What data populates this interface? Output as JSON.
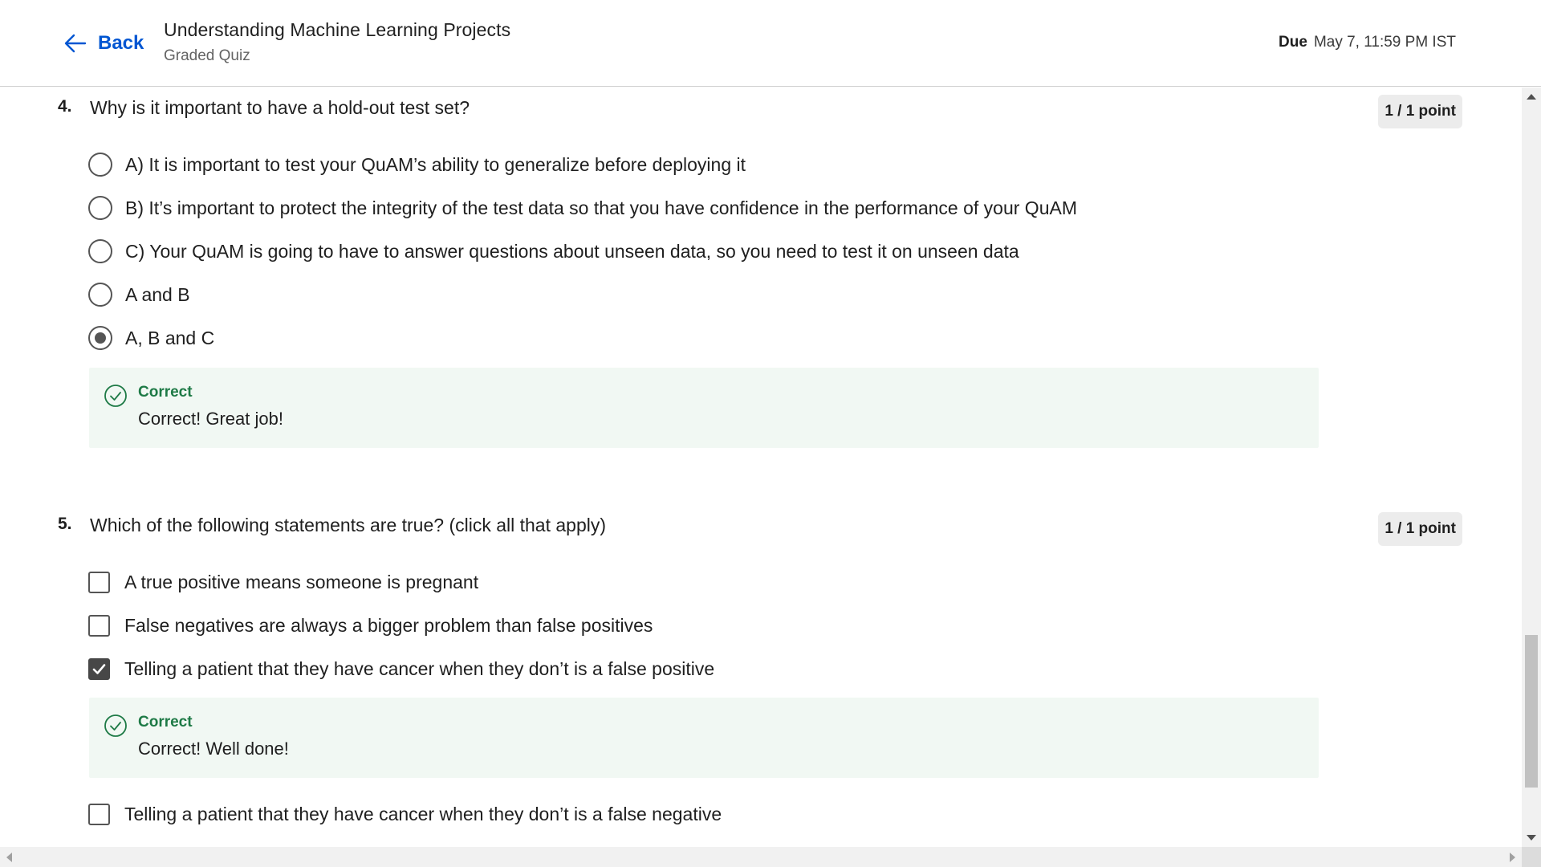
{
  "header": {
    "back_label": "Back",
    "course_title": "Understanding Machine Learning Projects",
    "quiz_type": "Graded Quiz",
    "due_label": "Due",
    "due_value": "May 7, 11:59 PM IST"
  },
  "questions": [
    {
      "number": "4.",
      "text": "Why is it important to have a hold-out test set?",
      "points": "1 / 1 point",
      "input_type": "radio",
      "options": [
        {
          "label": "A) It is important to test your QuAM’s ability to generalize before deploying it",
          "checked": false
        },
        {
          "label": "B) It’s important to protect the integrity of the test data so that you have confidence in the performance of your QuAM",
          "checked": false
        },
        {
          "label": "C) Your QuAM is going to have to answer questions about unseen data, so you need to test it on unseen data",
          "checked": false
        },
        {
          "label": "A and B",
          "checked": false
        },
        {
          "label": "A, B and C",
          "checked": true
        }
      ],
      "feedback": {
        "status": "Correct",
        "message": "Correct! Great job!"
      }
    },
    {
      "number": "5.",
      "text": "Which of the following statements are true? (click all that apply)",
      "points": "1 / 1 point",
      "input_type": "checkbox",
      "options": [
        {
          "label": "A true positive means someone is pregnant",
          "checked": false
        },
        {
          "label": "False negatives are always a bigger problem than false positives",
          "checked": false
        },
        {
          "label": "Telling a patient that they have cancer when they don’t is a false positive",
          "checked": true
        },
        {
          "label": "Telling a patient that they have cancer when they don’t is a false negative",
          "checked": false
        }
      ],
      "feedback": {
        "status": "Correct",
        "message": "Correct! Well done!"
      }
    }
  ],
  "colors": {
    "accent": "#0056d2",
    "correct_text": "#1e7a46",
    "feedback_bg": "#f1f8f3"
  },
  "icons": {
    "back": "arrow-left-icon",
    "feedback": "check-circle-icon",
    "checkmark": "checkmark-icon"
  }
}
